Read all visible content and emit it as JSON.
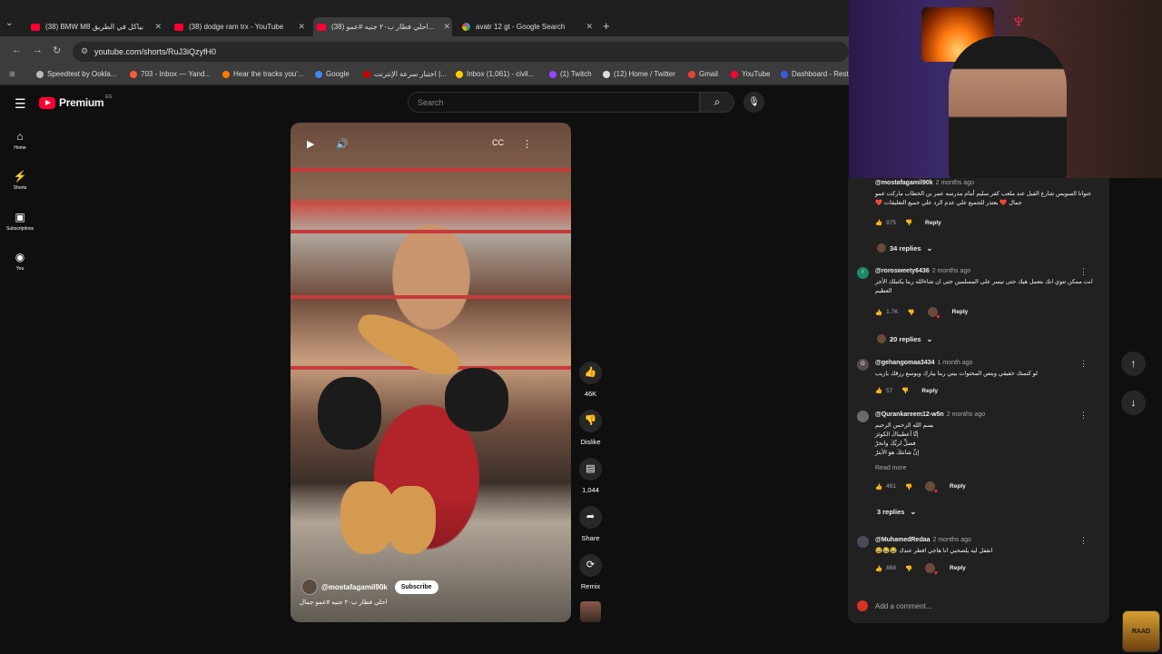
{
  "browser": {
    "tabs": [
      {
        "title": "(38) BMW M8 بياكل في الطريق",
        "type": "youtube"
      },
      {
        "title": "(38) dodge ram trx - YouTube",
        "type": "youtube"
      },
      {
        "title": "(38) احلي فطار ب٢٠ جنيه #عمو...",
        "type": "youtube",
        "active": true
      },
      {
        "title": "avatr 12 gt - Google Search",
        "type": "google"
      }
    ],
    "new_tab": "+",
    "url": "youtube.com/shorts/RuJ3iQzyfH0",
    "bookmarks": [
      {
        "label": "Speedtest by Ookla...",
        "color": "#bbbbbb"
      },
      {
        "label": "703 - Inbox — Yand...",
        "color": "#ff5a3a"
      },
      {
        "label": "Hear the tracks you'...",
        "color": "#ff7700"
      },
      {
        "label": "Google",
        "color": "#4285f4"
      },
      {
        "label": "اختبار سرعة الإنترنت |...",
        "color": "#cc0000"
      },
      {
        "label": "Inbox (1,061) - civil...",
        "color": "#ffcc00"
      },
      {
        "label": "(1) Twitch",
        "color": "#9146ff"
      },
      {
        "label": "(12) Home / Twitter",
        "color": "#dddddd"
      },
      {
        "label": "Gmail",
        "color": "#ea4335"
      },
      {
        "label": "YouTube",
        "color": "#ff0033"
      },
      {
        "label": "Dashboard - Rest",
        "color": "#3b5bdb"
      }
    ]
  },
  "youtube": {
    "logo_text": "Premium",
    "country_code": "EG",
    "search_placeholder": "Search",
    "rail": [
      {
        "label": "Home",
        "icon": "home-icon"
      },
      {
        "label": "Shorts",
        "icon": "shorts-icon"
      },
      {
        "label": "Subscriptions",
        "icon": "subscriptions-icon"
      },
      {
        "label": "You",
        "icon": "you-icon"
      }
    ]
  },
  "short": {
    "channel": "@mostafagamil90k",
    "subscribe_label": "Subscribe",
    "title": "احلي فطار ب٢٠ جنيه #عمو جمال",
    "actions": {
      "likes": "46K",
      "dislike": "Dislike",
      "comments": "1,044",
      "share": "Share",
      "remix": "Remix"
    }
  },
  "comments": {
    "items": [
      {
        "author": "@mostafagamil90k",
        "time": "2 months ago",
        "text": "عنوانا السويس شارع الفيل عند ملعب كفر سليم أمام مدرسه عمر بن الخطاب ماركت عمو جمال ❤️ بعتذر للجميع علي عدم الرد علي جميع التعليقات ❤️",
        "likes": "975",
        "reply": "Reply",
        "replies": "34 replies"
      },
      {
        "author": "@rorosweety6436",
        "time": "2 months ago",
        "text": "انت ممكن تتوي انك بتعمل هيك حتى تيسر على المسلمين حتى ان شاءالله ربنا يكتبلك الأجر العظيم",
        "likes": "1.7K",
        "reply": "Reply",
        "replies": "20 replies",
        "avatar_letter": "r",
        "avatar_color": "#1a8a6a"
      },
      {
        "author": "@gehangomaa3434",
        "time": "1 month ago",
        "text": "لو كتمتك حقيقي وبتص المحتوات بيتي ربنا يبارك ويوسع رزقك ياريب",
        "likes": "57",
        "reply": "Reply",
        "avatar_letter": "G",
        "avatar_color": "#5a4a4a"
      },
      {
        "author": "@Qurankareem12-w5n",
        "time": "2 months ago",
        "lines": [
          "بسم الله الرحمن الرحيم",
          "إنَّا أعطيناكَ الكوثرَ",
          "فصلِّ لربِّكَ وانحرْ",
          "إنَّ شانئكَ هوَ الأبترُ"
        ],
        "read_more": "Read more",
        "likes": "491",
        "reply": "Reply",
        "replies": "3 replies"
      },
      {
        "author": "@MuhamedRedaa",
        "time": "2 months ago",
        "text": "انقفل ليه يلصحبي انا هاجي افطر عندك 😂😂😂",
        "likes": "868",
        "reply": "Reply"
      }
    ],
    "add_placeholder": "Add a comment..."
  },
  "overlay": {
    "badge": "RAAD"
  }
}
